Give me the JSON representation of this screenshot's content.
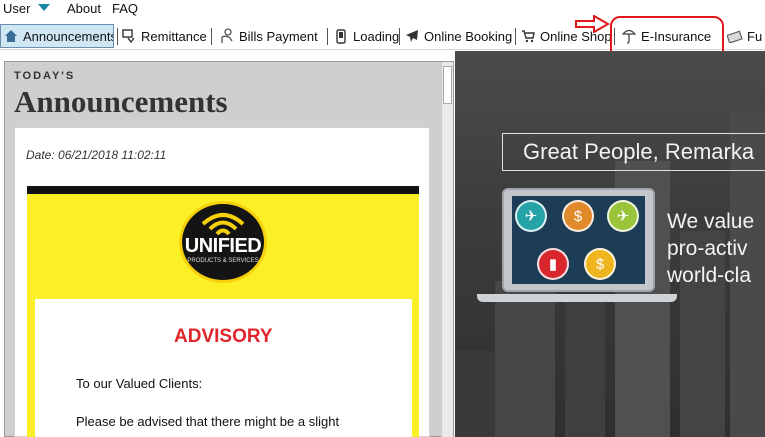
{
  "menu": {
    "user": "User",
    "about": "About",
    "faq": "FAQ"
  },
  "tabs": [
    {
      "label": "Announcements",
      "icon": "home-icon"
    },
    {
      "label": "Remittance",
      "icon": "remittance-icon"
    },
    {
      "label": "Bills Payment",
      "icon": "hand-coin-icon"
    },
    {
      "label": "Loading",
      "icon": "phone-icon"
    },
    {
      "label": "Online Booking",
      "icon": "airplane-icon"
    },
    {
      "label": "Online Shop",
      "icon": "cart-icon"
    },
    {
      "label": "E-Insurance",
      "icon": "umbrella-icon"
    },
    {
      "label": "Fu",
      "icon": "money-icon"
    }
  ],
  "hero": {
    "title": "Great People, Remarka",
    "text_lines": [
      "We value",
      "pro-activ",
      "world-cla"
    ]
  },
  "panel": {
    "kicker": "TODAY'S",
    "title": "Announcements",
    "date_line": "Date:  06/21/2018 11:02:11",
    "logo_text": "UNIFIED",
    "logo_sub": "PRODUCTS & SERVICES",
    "advisory_title": "ADVISORY",
    "advisory_p1": "To our Valued Clients:",
    "advisory_p2": "Please be advised that there might be a slight"
  },
  "colors": {
    "accent_blue": "#1c86a8",
    "highlight_red": "#e01818",
    "advisory_red": "#e0262b",
    "banner_yellow": "#fbef25"
  }
}
